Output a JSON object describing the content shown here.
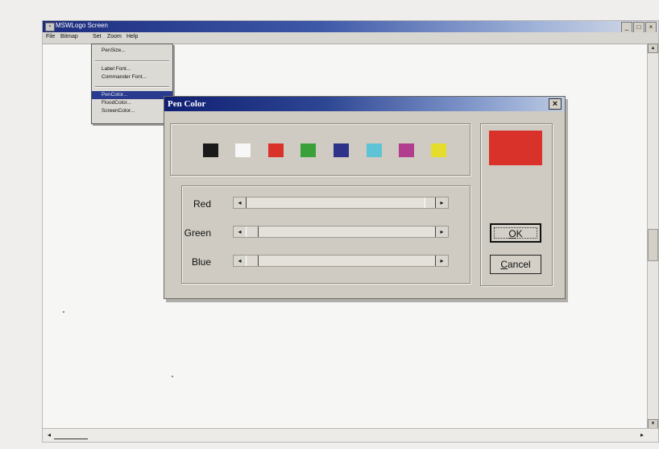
{
  "window": {
    "title": "MSWLogo Screen",
    "buttons": {
      "minimize": "_",
      "maximize": "□",
      "close": "×"
    }
  },
  "menubar": {
    "items": [
      "File",
      "Bitmap",
      "Set",
      "Zoom",
      "Help"
    ]
  },
  "set_menu": {
    "items": [
      {
        "label": "PenSize..."
      },
      {
        "label": "Label Font..."
      },
      {
        "label": "Commander Font..."
      },
      {
        "label": "PenColor...",
        "selected": true
      },
      {
        "label": "FloodColor..."
      },
      {
        "label": "ScreenColor..."
      }
    ]
  },
  "dialog": {
    "title": "Pen Color",
    "close_label": "×",
    "palette": [
      "#1a1a1a",
      "#f7f7f7",
      "#d8322a",
      "#3aa13a",
      "#2e3288",
      "#5fc3d6",
      "#b23c8e",
      "#e6dc2c"
    ],
    "preview_color": "#d8322a",
    "sliders": [
      {
        "label": "Red",
        "value_fraction": 1.0
      },
      {
        "label": "Green",
        "value_fraction": 0.0
      },
      {
        "label": "Blue",
        "value_fraction": 0.0
      }
    ],
    "ok": {
      "accel": "O",
      "rest": "K"
    },
    "cancel": {
      "accel": "C",
      "rest": "ancel"
    }
  },
  "scroll": {
    "left_arrow": "◂",
    "right_arrow": "▸",
    "up_arrow": "▴",
    "down_arrow": "▾"
  }
}
